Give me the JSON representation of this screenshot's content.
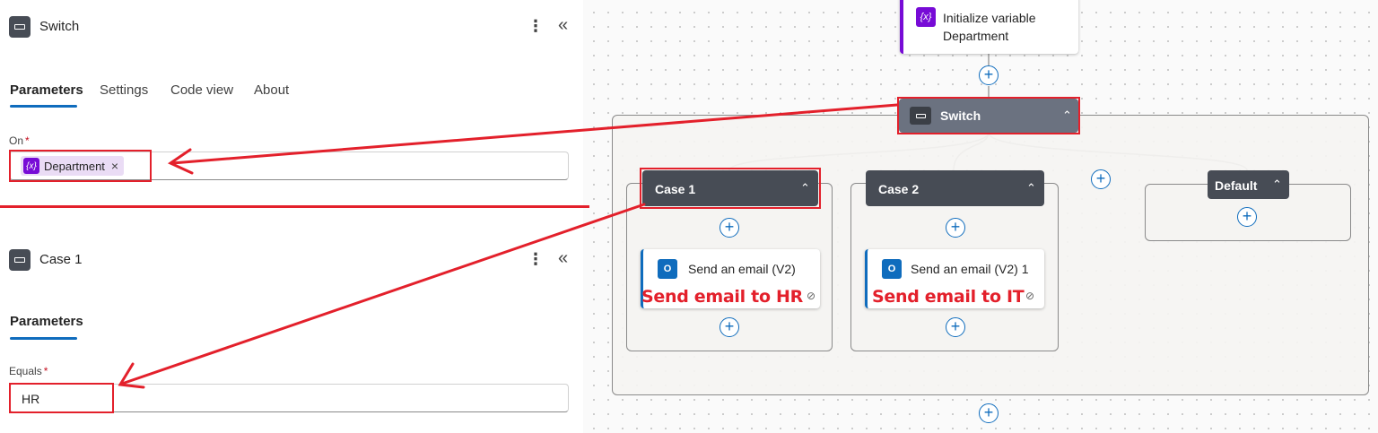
{
  "switch_panel": {
    "title": "Switch",
    "tabs": [
      {
        "label": "Parameters",
        "active": true
      },
      {
        "label": "Settings",
        "active": false
      },
      {
        "label": "Code view",
        "active": false
      },
      {
        "label": "About",
        "active": false
      }
    ],
    "on_label": "On",
    "required_mark": "*",
    "on_token": {
      "icon_text": "{x}",
      "label": "Department",
      "remove_glyph": "×"
    }
  },
  "case_panel": {
    "title": "Case 1",
    "tabs": [
      {
        "label": "Parameters",
        "active": true
      }
    ],
    "equals_label": "Equals",
    "required_mark": "*",
    "equals_value": "HR"
  },
  "icons": {
    "more": "⋮",
    "collapse": "«",
    "chevron_up": "⌃",
    "plus": "+",
    "link": "⊘",
    "var_glyph": "{x}",
    "mail_glyph": "O"
  },
  "flow": {
    "init_variable": {
      "title_line1": "Initialize variable",
      "title_line2": "Department"
    },
    "switch": {
      "label": "Switch"
    },
    "cases": [
      {
        "label": "Case 1",
        "action": {
          "title": "Send an email (V2)",
          "annotation": "Send email to HR"
        }
      },
      {
        "label": "Case 2",
        "action": {
          "title": "Send an email (V2) 1",
          "annotation": "Send email to IT"
        }
      }
    ],
    "default": {
      "label": "Default"
    }
  },
  "colors": {
    "accent_blue": "#0f6cbd",
    "variable_purple": "#770bd6",
    "annotation_red": "#e3202b",
    "node_dark": "#474c55"
  }
}
